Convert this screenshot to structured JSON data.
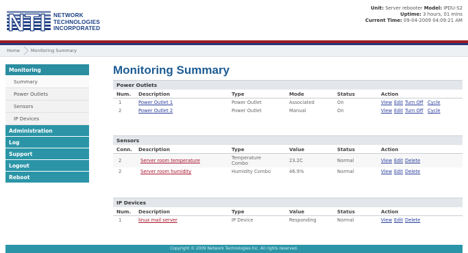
{
  "header": {
    "logo_lines": [
      "NETWORK",
      "TECHNOLOGIES",
      "INCORPORATED"
    ],
    "unit_label": "Unit:",
    "unit_value": "Server rebooter",
    "model_label": "Model:",
    "model_value": "IPDU-S2",
    "uptime_label": "Uptime:",
    "uptime_value": "3 hours, 01 mins",
    "time_label": "Current Time:",
    "time_value": "09-04-2009 04:09:21 AM"
  },
  "breadcrumb": {
    "home": "Home",
    "current": "Monitoring Summary"
  },
  "sidebar": {
    "monitoring": "Monitoring",
    "monitoring_items": [
      "Summary",
      "Power Outlets",
      "Sensors",
      "IP Devices"
    ],
    "administration": "Administration",
    "log": "Log",
    "support": "Support",
    "logout": "Logout",
    "reboot": "Reboot"
  },
  "main": {
    "title": "Monitoring Summary",
    "power": {
      "heading": "Power Outlets",
      "columns": [
        "Num.",
        "Description",
        "Type",
        "Mode",
        "Status",
        "Action"
      ],
      "rows": [
        {
          "num": "1",
          "desc": "Power Outlet 1",
          "type": "Power Outlet",
          "mode": "Associated",
          "status": "On",
          "actions": [
            "View",
            "Edit",
            "Turn Off",
            "Cycle"
          ]
        },
        {
          "num": "2",
          "desc": "Power Outlet 2",
          "type": "Power Outlet",
          "mode": "Manual",
          "status": "On",
          "actions": [
            "View",
            "Edit",
            "Turn Off",
            "Cycle"
          ]
        }
      ]
    },
    "sensors": {
      "heading": "Sensors",
      "columns": [
        "Conn.",
        "Description",
        "Type",
        "Value",
        "Status",
        "Action"
      ],
      "rows": [
        {
          "num": "2",
          "desc": "Server room temperature",
          "type_line1": "Temperature",
          "type_line2": "Combo",
          "value": "23.2C",
          "status": "Normal",
          "actions": [
            "View",
            "Edit",
            "Delete"
          ]
        },
        {
          "num": "2",
          "desc": "Server room humidity",
          "type": "Humidity Combo",
          "value": "46.9%",
          "status": "Normal",
          "actions": [
            "View",
            "Edit",
            "Delete"
          ]
        }
      ]
    },
    "ipdevices": {
      "heading": "IP Devices",
      "columns": [
        "Num.",
        "Description",
        "Type",
        "Value",
        "Status",
        "Action"
      ],
      "rows": [
        {
          "num": "1",
          "desc": "linux mail server",
          "type": "IP Device",
          "value": "Responding",
          "status": "Normal",
          "actions": [
            "View",
            "Edit",
            "Delete"
          ]
        }
      ]
    }
  },
  "footer": {
    "text": "Copyright © 2009 Network Technologies Inc. All rights reserved."
  },
  "colors": {
    "nav": "#2b95a7",
    "title": "#1d5c93",
    "link": "#2a3d9c",
    "desc_link": "#a8112b",
    "rule_red": "#9b1b22",
    "rule_blue": "#23367a"
  }
}
